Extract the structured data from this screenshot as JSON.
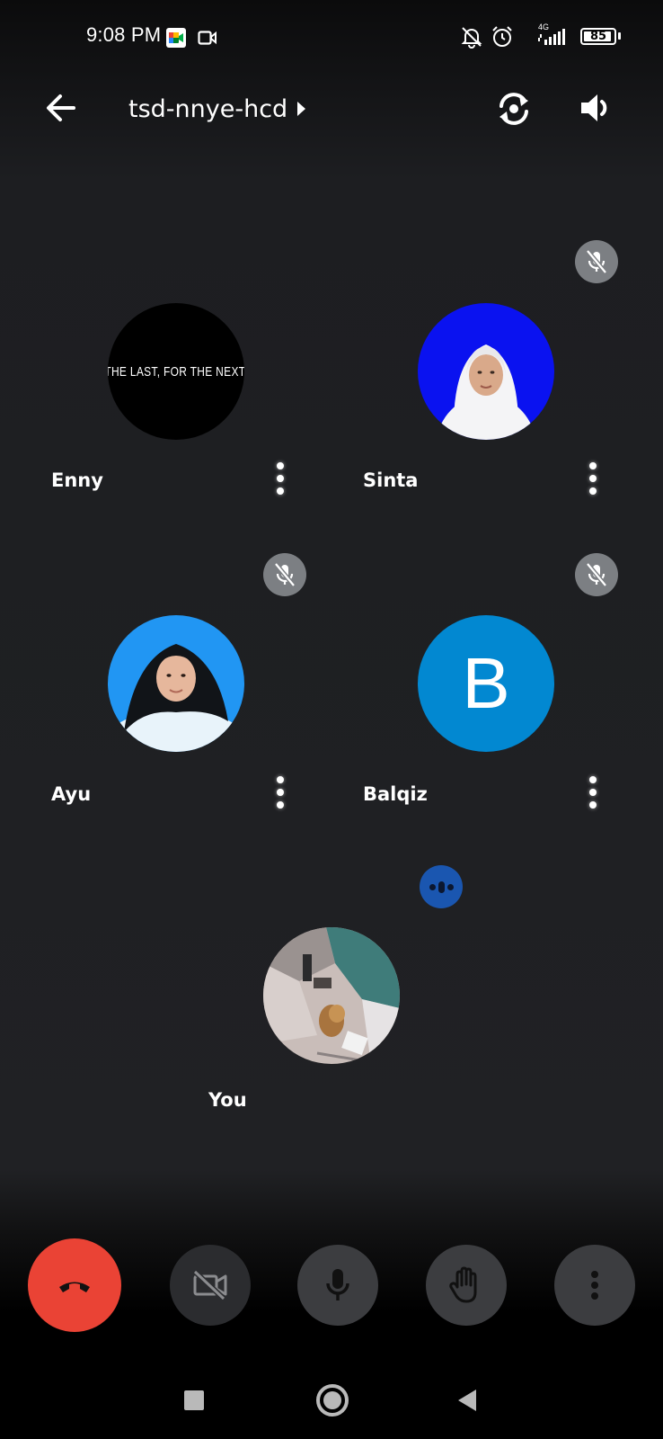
{
  "status_bar": {
    "time": "9:08 PM",
    "network": "4G",
    "battery": "85",
    "icons": [
      "google-meet-icon",
      "video-camera-icon",
      "bell-off-icon",
      "alarm-icon",
      "signal-icon",
      "battery-icon"
    ]
  },
  "top_bar": {
    "back_icon": "arrow-left-icon",
    "meeting_code": "tsd-nnye-hcd",
    "expand_icon": "caret-right-icon",
    "switch_camera_icon": "camera-switch-icon",
    "audio_icon": "speaker-icon"
  },
  "participants": [
    {
      "name": "Enny",
      "avatar_text": "THE LAST, FOR THE NEXT.",
      "muted": false
    },
    {
      "name": "Sinta",
      "muted": true,
      "avatar_color": "#0a12f0"
    },
    {
      "name": "Ayu",
      "muted": true,
      "avatar_color": "#2196f3"
    },
    {
      "name": "Balqiz",
      "initial": "B",
      "muted": true,
      "avatar_color": "#0288d1"
    }
  ],
  "self": {
    "name": "You",
    "speaking": true
  },
  "controls": {
    "end_call": "end-call-icon",
    "camera": "camera-off-icon",
    "mic": "microphone-icon",
    "raise_hand": "hand-icon",
    "more": "more-vert-icon"
  },
  "colors": {
    "end_call": "#ea4335",
    "mute_badge": "#7c7f83",
    "speaking_badge": "#1a56b0",
    "balqiz_avatar": "#0288d1"
  }
}
